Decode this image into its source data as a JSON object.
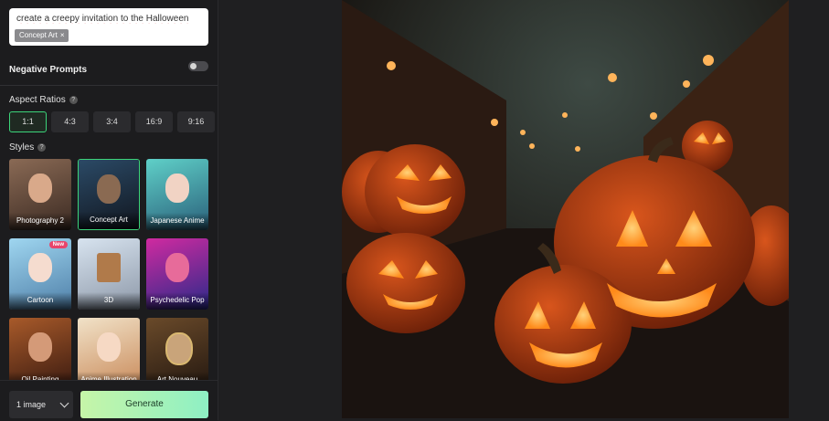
{
  "prompt": {
    "text": "create a creepy invitation to the Halloween",
    "tag": "Concept Art",
    "tag_close": "×"
  },
  "negative_prompts": {
    "label": "Negative Prompts",
    "enabled": false
  },
  "aspect_ratios": {
    "label": "Aspect Ratios",
    "help": "?",
    "options": [
      "1:1",
      "4:3",
      "3:4",
      "16:9",
      "9:16"
    ],
    "selected": "1:1"
  },
  "styles": {
    "label": "Styles",
    "help": "?",
    "selected": "Concept Art",
    "items": [
      {
        "label": "Photography 2",
        "badge": ""
      },
      {
        "label": "Concept Art",
        "badge": ""
      },
      {
        "label": "Japanese Anime",
        "badge": ""
      },
      {
        "label": "Cartoon",
        "badge": "New"
      },
      {
        "label": "3D",
        "badge": ""
      },
      {
        "label": "Psychedelic Pop",
        "badge": ""
      },
      {
        "label": "Oil Painting",
        "badge": ""
      },
      {
        "label": "Anime Illustration",
        "badge": ""
      },
      {
        "label": "Art Nouveau",
        "badge": ""
      }
    ]
  },
  "footer": {
    "image_count": "1 image",
    "generate_label": "Generate"
  },
  "colors": {
    "accent": "#3cd47a",
    "generate_gradient_start": "#c6f5a8",
    "generate_gradient_end": "#8ef0c4"
  }
}
